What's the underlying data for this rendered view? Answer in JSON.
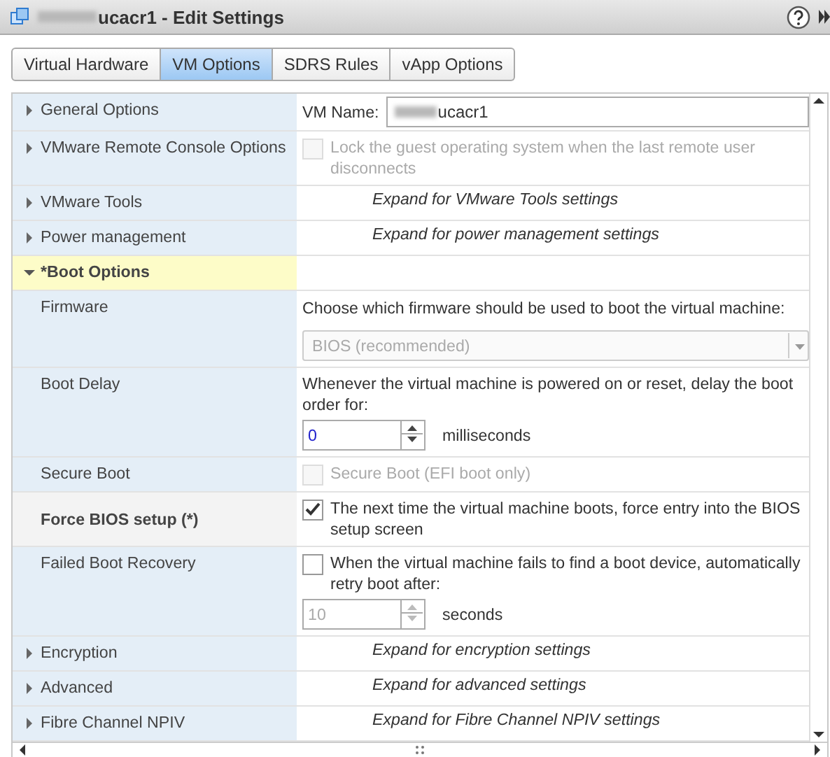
{
  "window": {
    "title": "ucacr1 - Edit Settings",
    "title_redacted": true
  },
  "tabs": [
    {
      "label": "Virtual Hardware",
      "selected": false
    },
    {
      "label": "VM Options",
      "selected": true
    },
    {
      "label": "SDRS Rules",
      "selected": false
    },
    {
      "label": "vApp Options",
      "selected": false
    }
  ],
  "rows": [
    {
      "label": "General Options",
      "kind": "name",
      "expanded": false,
      "selected": false,
      "field_label": "VM Name:",
      "value": "ucacr1",
      "value_redacted": true
    },
    {
      "label": "VMware Remote Console Options",
      "kind": "checkbox",
      "expanded": false,
      "selected": false,
      "checked": false,
      "disabled": true,
      "text": "Lock the guest operating system when the last remote user disconnects"
    },
    {
      "label": "VMware Tools",
      "kind": "hint",
      "expanded": false,
      "selected": false,
      "hint": "Expand for VMware Tools settings"
    },
    {
      "label": "Power management",
      "kind": "hint",
      "expanded": false,
      "selected": false,
      "hint": "Expand for power management settings"
    },
    {
      "label": "*Boot Options",
      "kind": "group",
      "expanded": true,
      "selected": true,
      "children": [
        {
          "label": "Firmware",
          "kind": "select",
          "emphasized": false,
          "text": "Choose which firmware should be used to boot the virtual machine:",
          "value": "BIOS (recommended)",
          "disabled": true
        },
        {
          "label": "Boot Delay",
          "kind": "number",
          "emphasized": false,
          "text": "Whenever the virtual machine is powered on or reset, delay the boot order for:",
          "value": "0",
          "unit": "milliseconds",
          "disabled": false
        },
        {
          "label": "Secure Boot",
          "kind": "checkbox",
          "emphasized": false,
          "checked": false,
          "disabled": true,
          "text": "Secure Boot (EFI boot only)"
        },
        {
          "label": "Force BIOS setup (*)",
          "kind": "checkbox",
          "emphasized": true,
          "checked": true,
          "disabled": false,
          "text": "The next time the virtual machine boots, force entry into the BIOS setup screen"
        },
        {
          "label": "Failed Boot Recovery",
          "kind": "checkbox_number",
          "emphasized": false,
          "checked": false,
          "disabled": false,
          "text": "When the virtual machine fails to find a boot device, automatically retry boot after:",
          "value": "10",
          "unit": "seconds",
          "value_disabled": true
        }
      ]
    },
    {
      "label": "Encryption",
      "kind": "hint",
      "expanded": false,
      "selected": false,
      "hint": "Expand for encryption settings"
    },
    {
      "label": "Advanced",
      "kind": "hint",
      "expanded": false,
      "selected": false,
      "hint": "Expand for advanced settings"
    },
    {
      "label": "Fibre Channel NPIV",
      "kind": "hint",
      "expanded": false,
      "selected": false,
      "hint": "Expand for Fibre Channel NPIV settings"
    }
  ]
}
